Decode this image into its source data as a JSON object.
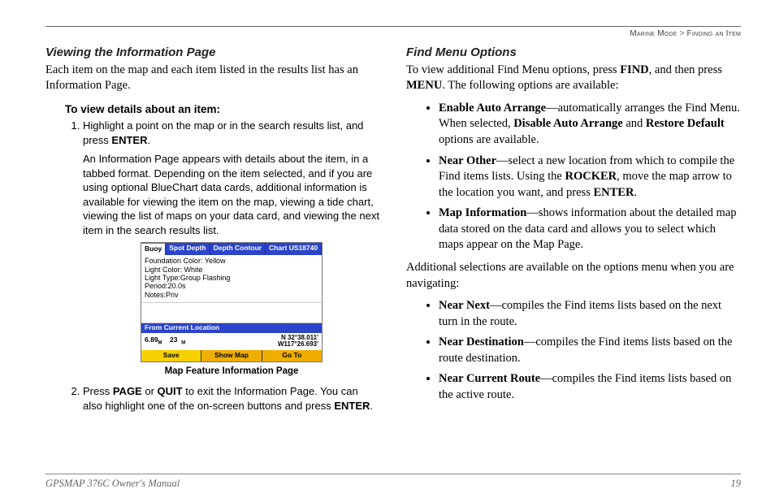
{
  "breadcrumb": {
    "section": "Marine Mode",
    "sep": ">",
    "sub": "Finding an Item"
  },
  "left": {
    "h": "Viewing the Information Page",
    "intro": "Each item on the map and each item listed in the results list has an Information Page.",
    "task_head": "To view details about an item:",
    "step1_a": "Highlight a point on the map or in the search results list, and press ",
    "step1_b": "ENTER",
    "step1_c": ".",
    "step1_detail": "An Information Page appears with details about the item, in a tabbed format. Depending on the item selected, and if you are using optional BlueChart data cards, additional information is available for viewing the item on the map, viewing a tide chart, viewing the list of maps on your data card, and viewing the next item in the search results list.",
    "caption": "Map Feature Information Page",
    "step2_a": "Press ",
    "step2_b": "PAGE",
    "step2_c": " or ",
    "step2_d": "QUIT",
    "step2_e": " to exit the Information Page. You can also highlight one of the on-screen buttons and press ",
    "step2_f": "ENTER",
    "step2_g": "."
  },
  "shot": {
    "tabs": [
      "Buoy",
      "Spot Depth",
      "Depth Contour",
      "Chart US18740"
    ],
    "lines": [
      "Foundation Color: Yellow",
      "Light Color: White",
      "Light Type:Group Flashing",
      "Period:20.0s",
      "Notes:Priv"
    ],
    "section": "From Current Location",
    "dist": "6.89",
    "brg": "23",
    "unit": "M",
    "lat": "N  32°38.011'",
    "lon": "W117°26.693'",
    "buttons": [
      "Save",
      "Show Map",
      "Go To"
    ]
  },
  "right": {
    "h": "Find Menu Options",
    "intro_a": "To view additional Find Menu options, press ",
    "intro_b": "FIND",
    "intro_c": ", and then press ",
    "intro_d": "MENU",
    "intro_e": ". The following options are available:",
    "b1_a": "Enable Auto Arrange",
    "b1_b": "—automatically arranges the Find Menu. When selected, ",
    "b1_c": "Disable Auto Arrange",
    "b1_d": " and ",
    "b1_e": "Restore Default",
    "b1_f": " options are available.",
    "b2_a": "Near Other",
    "b2_b": "—select a new location from which to compile the Find items lists. Using the ",
    "b2_c": "ROCKER",
    "b2_d": ", move the map arrow to the location you want, and press ",
    "b2_e": "ENTER",
    "b2_f": ".",
    "b3_a": "Map Information",
    "b3_b": "—shows information about the detailed map data stored on the data card and allows you to select which maps appear on the Map Page.",
    "mid": "Additional selections are available on the options menu when you are navigating:",
    "b4_a": "Near Next",
    "b4_b": "—compiles the Find items lists based on the next turn in the route.",
    "b5_a": "Near Destination",
    "b5_b": "—compiles the Find items lists based on the route destination.",
    "b6_a": "Near Current Route",
    "b6_b": "—compiles the Find items lists based on the active route."
  },
  "footer": {
    "left": "GPSMAP 376C Owner's Manual",
    "right": "19"
  }
}
